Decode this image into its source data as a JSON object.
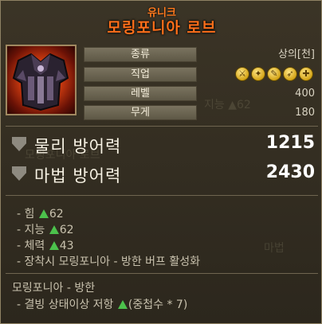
{
  "item": {
    "rarity": "유니크",
    "name": "모링포니아 로브"
  },
  "stats": [
    {
      "label": "종류",
      "value": "상의[천]"
    },
    {
      "label": "직업",
      "value": ""
    },
    {
      "label": "레벨",
      "value": "400"
    },
    {
      "label": "무게",
      "value": "180"
    }
  ],
  "class_icons": [
    "class-icon-1",
    "class-icon-2",
    "class-icon-3",
    "class-icon-4",
    "class-icon-5"
  ],
  "defense": {
    "physical_label": "물리 방어력",
    "physical_value": "1215",
    "magic_label": "마법 방어력",
    "magic_value": "2430"
  },
  "bonuses": [
    {
      "prefix": "- 힘 ",
      "value": "62"
    },
    {
      "prefix": "- 지능 ",
      "value": "62"
    },
    {
      "prefix": "- 체력 ",
      "value": "43"
    }
  ],
  "equip_effect": "- 장착시 모링포니아 - 방한 버프 활성화",
  "set": {
    "title": "모링포니아 - 방한",
    "effect_prefix": "- 결빙 상태이상 저항 ",
    "effect_suffix": "(중첩수 * 7)"
  },
  "colors": {
    "rarity": "#ff7a1e",
    "up_arrow": "#4cc24c"
  }
}
